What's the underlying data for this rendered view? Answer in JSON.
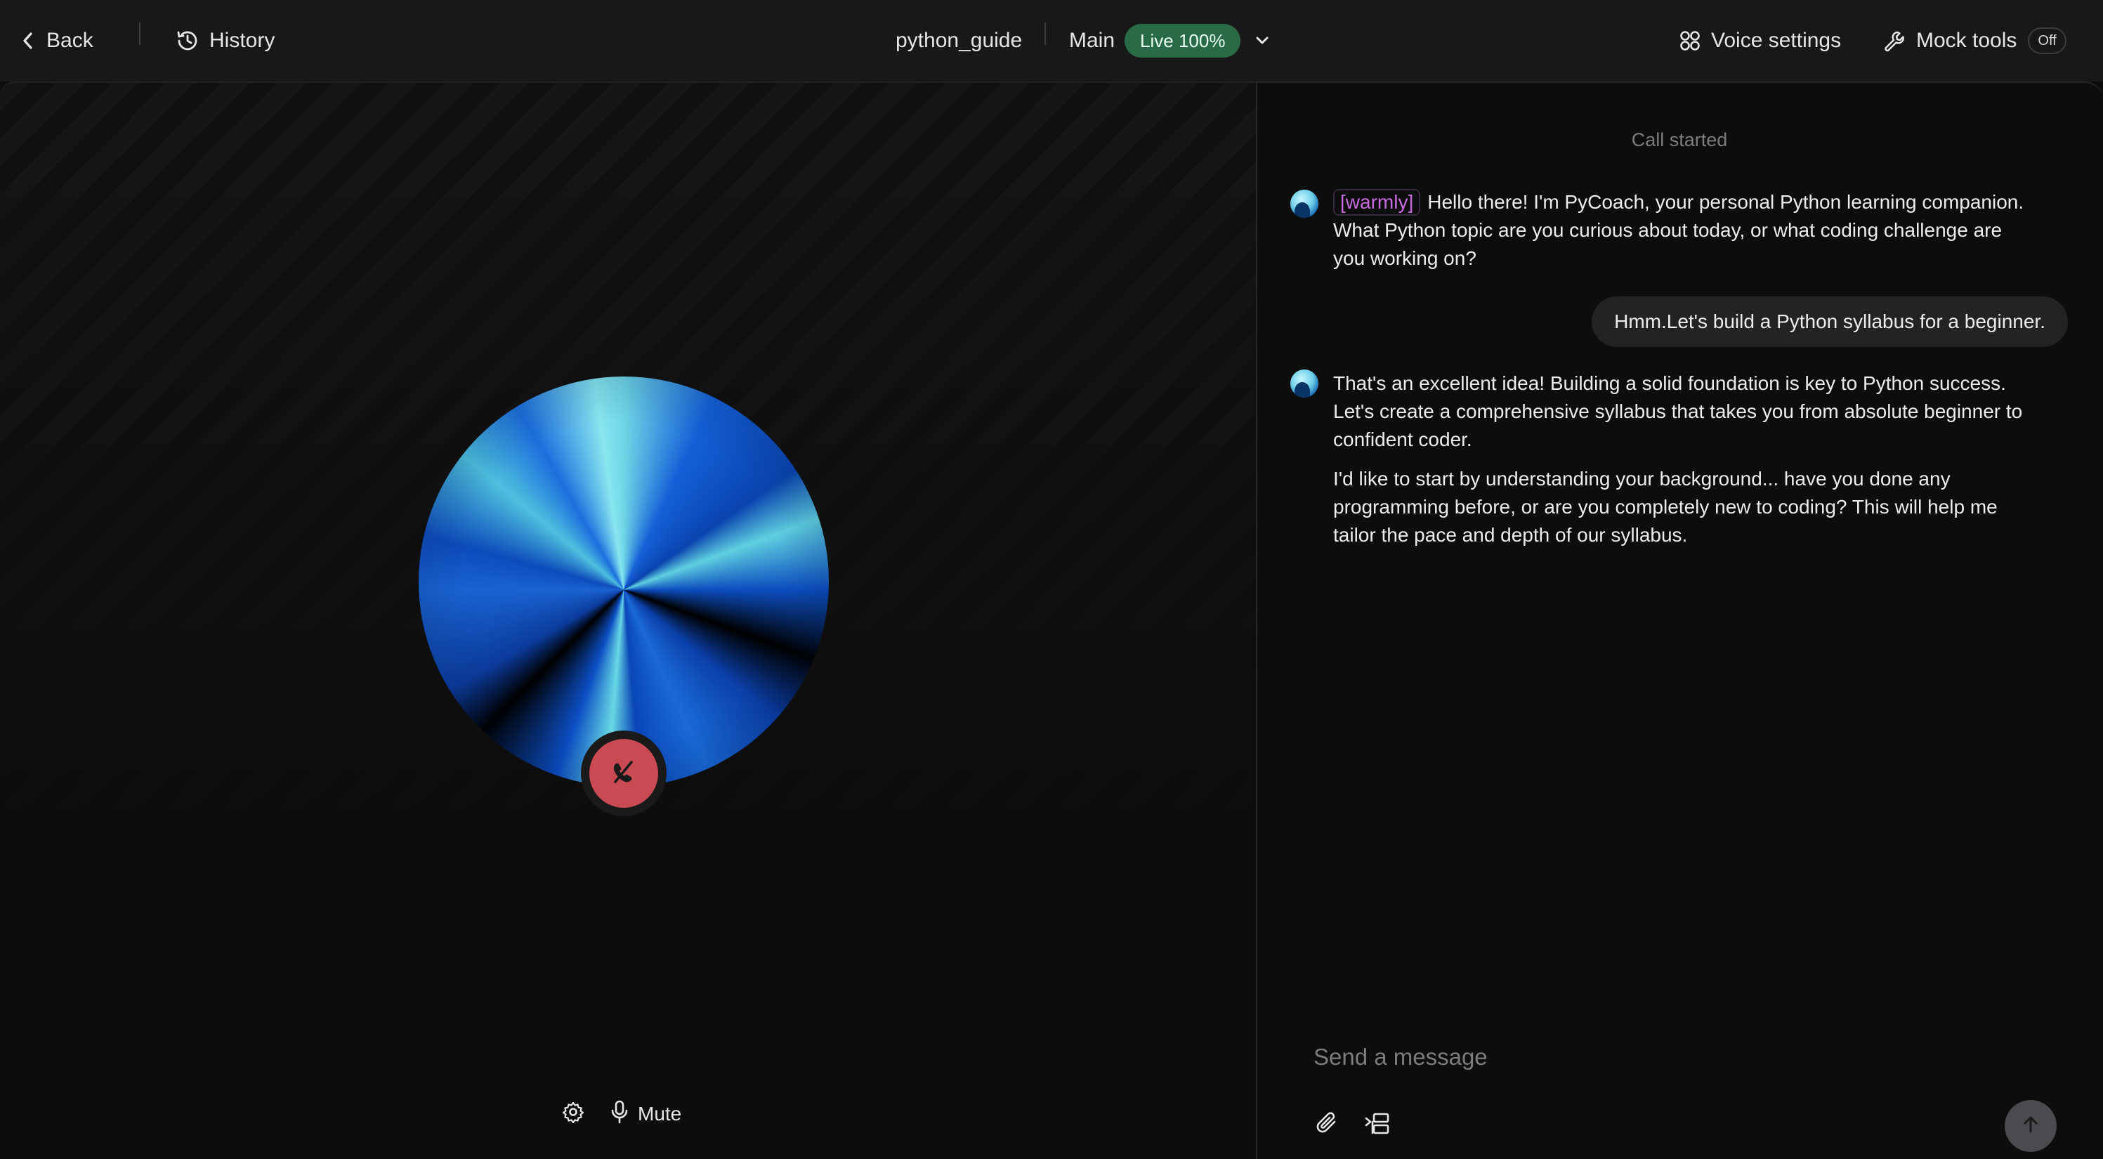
{
  "header": {
    "back_label": "Back",
    "history_label": "History",
    "project_name": "python_guide",
    "branch_label": "Main",
    "live_badge": "Live 100%",
    "voice_settings_label": "Voice settings",
    "mock_tools_label": "Mock tools",
    "mock_tools_state": "Off"
  },
  "call": {
    "mute_label": "Mute",
    "hangup_color": "#c94a52"
  },
  "transcript": {
    "status": "Call started",
    "messages": [
      {
        "role": "assistant",
        "tag": "[warmly]",
        "text": "Hello there! I'm PyCoach, your personal Python learning companion. What Python topic are you curious about today, or what coding challenge are you working on?"
      },
      {
        "role": "user",
        "text": "Hmm.Let's build a Python syllabus for a beginner."
      },
      {
        "role": "assistant",
        "paragraphs": [
          "That's an excellent idea! Building a solid foundation is key to Python success. Let's create a comprehensive syllabus that takes you from absolute beginner to confident coder.",
          "I'd like to start by understanding your background... have you done any programming before, or are you completely new to coding? This will help me tailor the pace and depth of our syllabus."
        ]
      }
    ]
  },
  "composer": {
    "placeholder": "Send a message"
  },
  "colors": {
    "live_badge_bg": "#2a6b47",
    "tag_color": "#c86ae0",
    "background": "#0d0d0d"
  }
}
